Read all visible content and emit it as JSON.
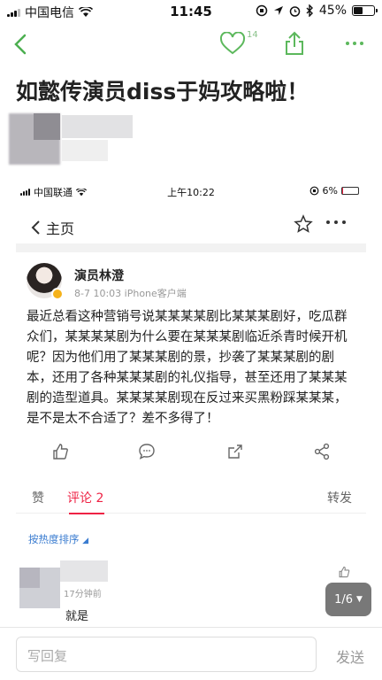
{
  "status_bar": {
    "carrier": "中国电信",
    "time": "11:45",
    "battery": "45%",
    "battery_level": 0.45
  },
  "nav": {
    "like_count": "14",
    "back_icon": "chevron-left-icon",
    "like_icon": "heart-icon",
    "share_icon": "share-icon",
    "more_icon": "more-icon"
  },
  "article": {
    "title": "如懿传演员diss于妈攻略啦！"
  },
  "screenshot": {
    "status_bar": {
      "carrier": "中国联通",
      "time": "上午10:22",
      "battery": "6%",
      "battery_level": 0.06
    },
    "nav": {
      "back_label": "主页"
    },
    "post": {
      "author": "演员林澄",
      "meta": "8-7 10:03  iPhone客户端",
      "text": "最近总看这种营销号说某某某某剧比某某某剧好，吃瓜群众们，某某某某剧为什么要在某某某剧临近杀青时候开机呢？因为他们用了某某某剧的景，抄袭了某某某剧的剧本，还用了各种某某某剧的礼仪指导，甚至还用了某某某剧的造型道具。某某某某剧现在反过来买黑粉踩某某某，是不是太不合适了？差不多得了！"
    },
    "tabs": {
      "like": "赞",
      "comments": "评论 2",
      "repost": "转发"
    },
    "sort_label": "按热度排序",
    "comment": {
      "time": "17分钟前",
      "text": "就是"
    }
  },
  "pager": {
    "label": "1/6"
  },
  "bottom_bar": {
    "reply_placeholder": "写回复",
    "send_label": "发送"
  },
  "colors": {
    "accent_green": "#6db56d",
    "accent_red": "#e82244",
    "link_blue": "#3a7cd0"
  }
}
